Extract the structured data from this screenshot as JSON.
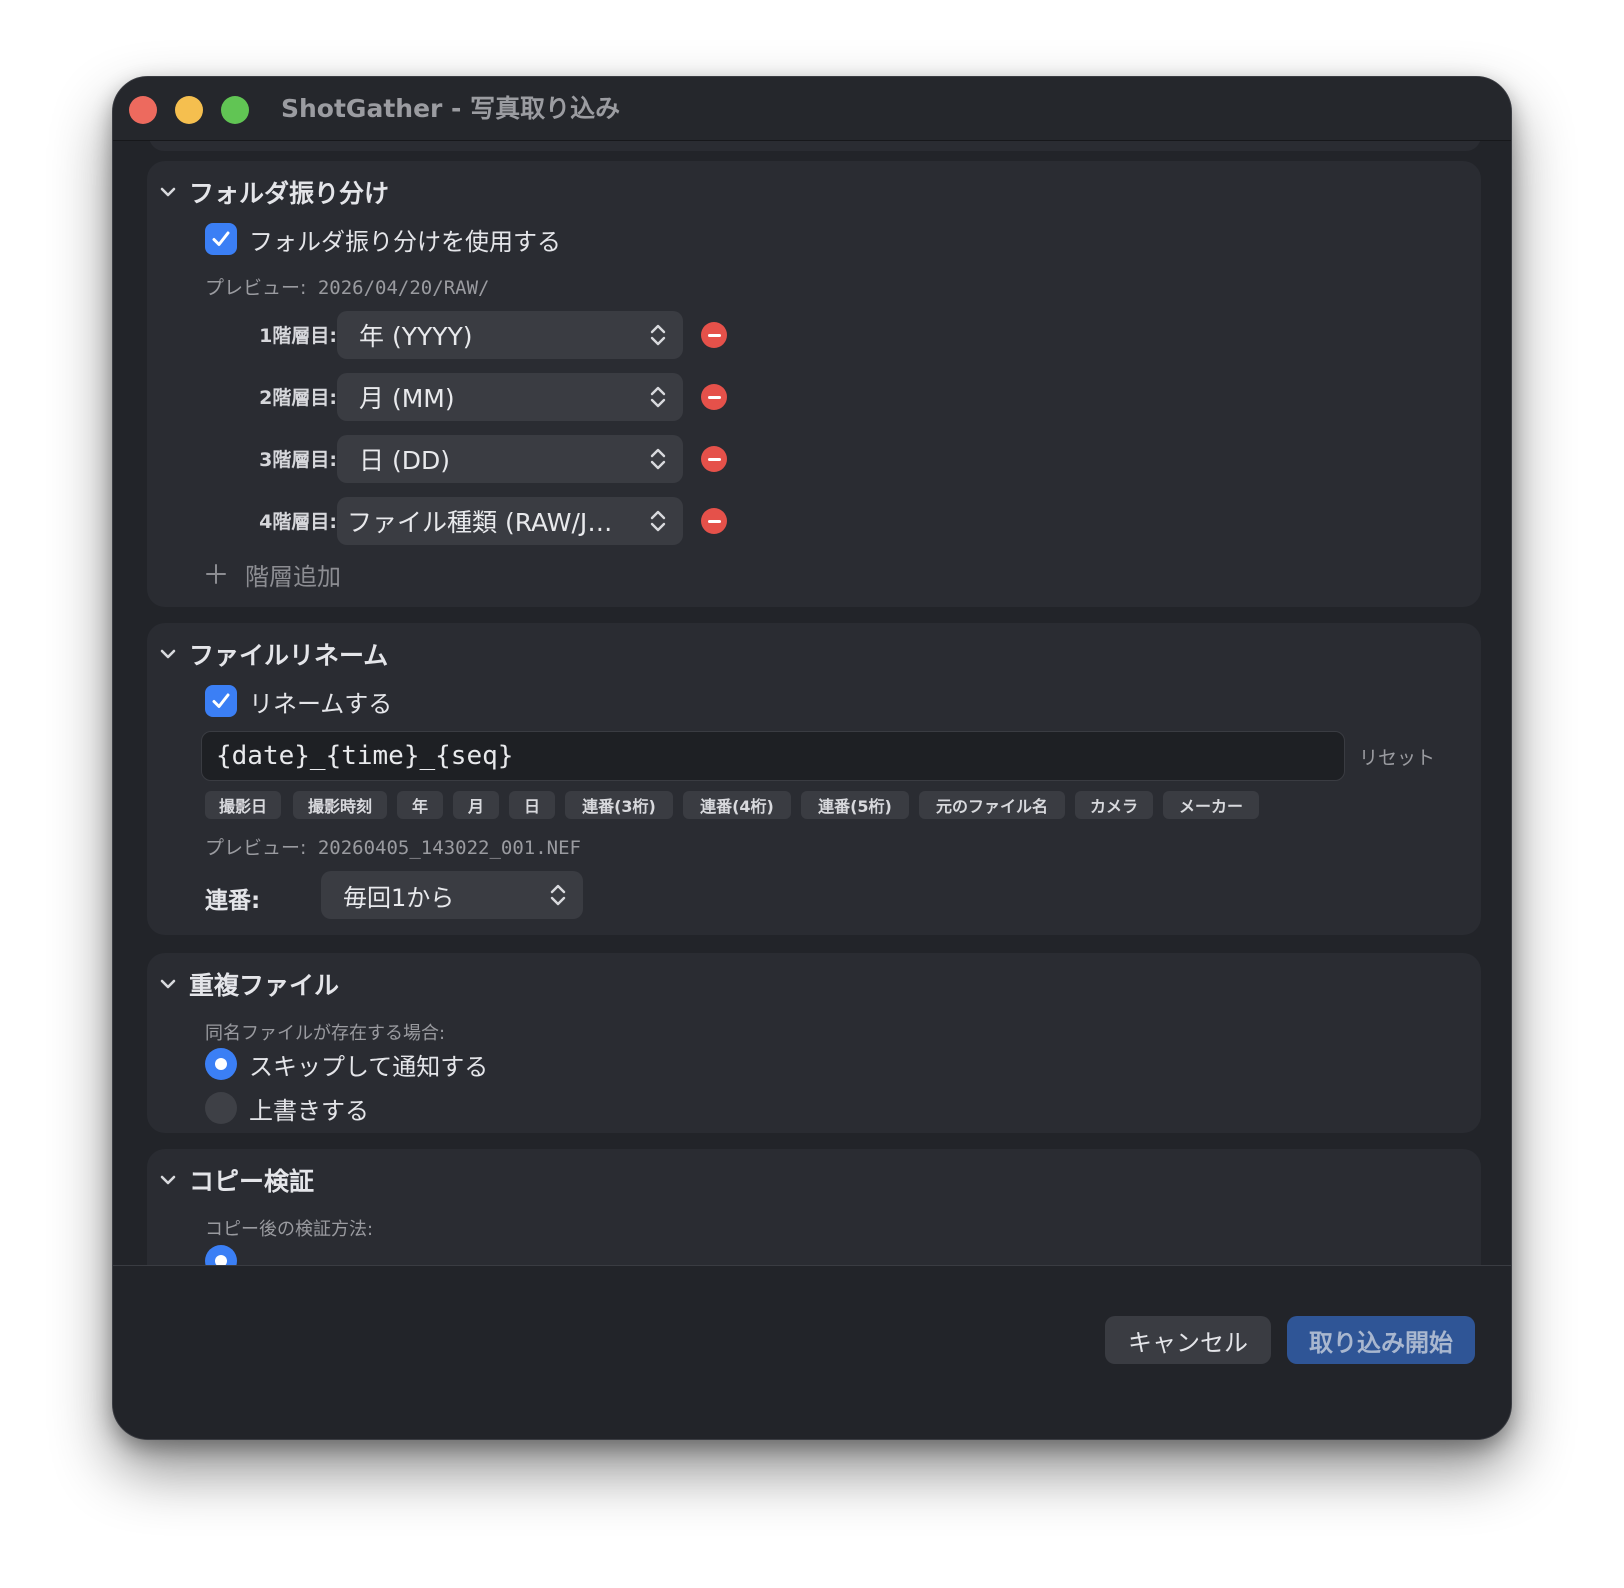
{
  "window": {
    "title": "ShotGather - 写真取り込み"
  },
  "folder_section": {
    "title": "フォルダ振り分け",
    "enable_label": "フォルダ振り分けを使用する",
    "enabled": true,
    "preview_label": "プレビュー:",
    "preview_value": "2026/04/20/RAW/",
    "levels": [
      {
        "label": "1階層目:",
        "value": "年 (YYYY)"
      },
      {
        "label": "2階層目:",
        "value": "月 (MM)"
      },
      {
        "label": "3階層目:",
        "value": "日 (DD)"
      },
      {
        "label": "4階層目:",
        "value": "ファイル種類 (RAW/JPEG)"
      }
    ],
    "add_label": "階層追加"
  },
  "rename_section": {
    "title": "ファイルリネーム",
    "enable_label": "リネームする",
    "enabled": true,
    "pattern": "{date}_{time}_{seq}",
    "reset_label": "リセット",
    "tokens": [
      "撮影日",
      "撮影時刻",
      "年",
      "月",
      "日",
      "連番(3桁)",
      "連番(4桁)",
      "連番(5桁)",
      "元のファイル名",
      "カメラ",
      "メーカー"
    ],
    "preview_label": "プレビュー:",
    "preview_value": "20260405_143022_001.NEF",
    "seq_label": "連番:",
    "seq_value": "毎回1から"
  },
  "duplicate_section": {
    "title": "重複ファイル",
    "sub_label": "同名ファイルが存在する場合:",
    "options": [
      {
        "label": "スキップして通知する",
        "selected": true
      },
      {
        "label": "上書きする",
        "selected": false
      }
    ]
  },
  "verify_section": {
    "title": "コピー検証",
    "sub_label": "コピー後の検証方法:"
  },
  "footer": {
    "cancel_label": "キャンセル",
    "start_label": "取り込み開始"
  },
  "colors": {
    "accent": "#3b7ff5",
    "danger": "#e5514a",
    "primary_button": "#2f5596"
  }
}
